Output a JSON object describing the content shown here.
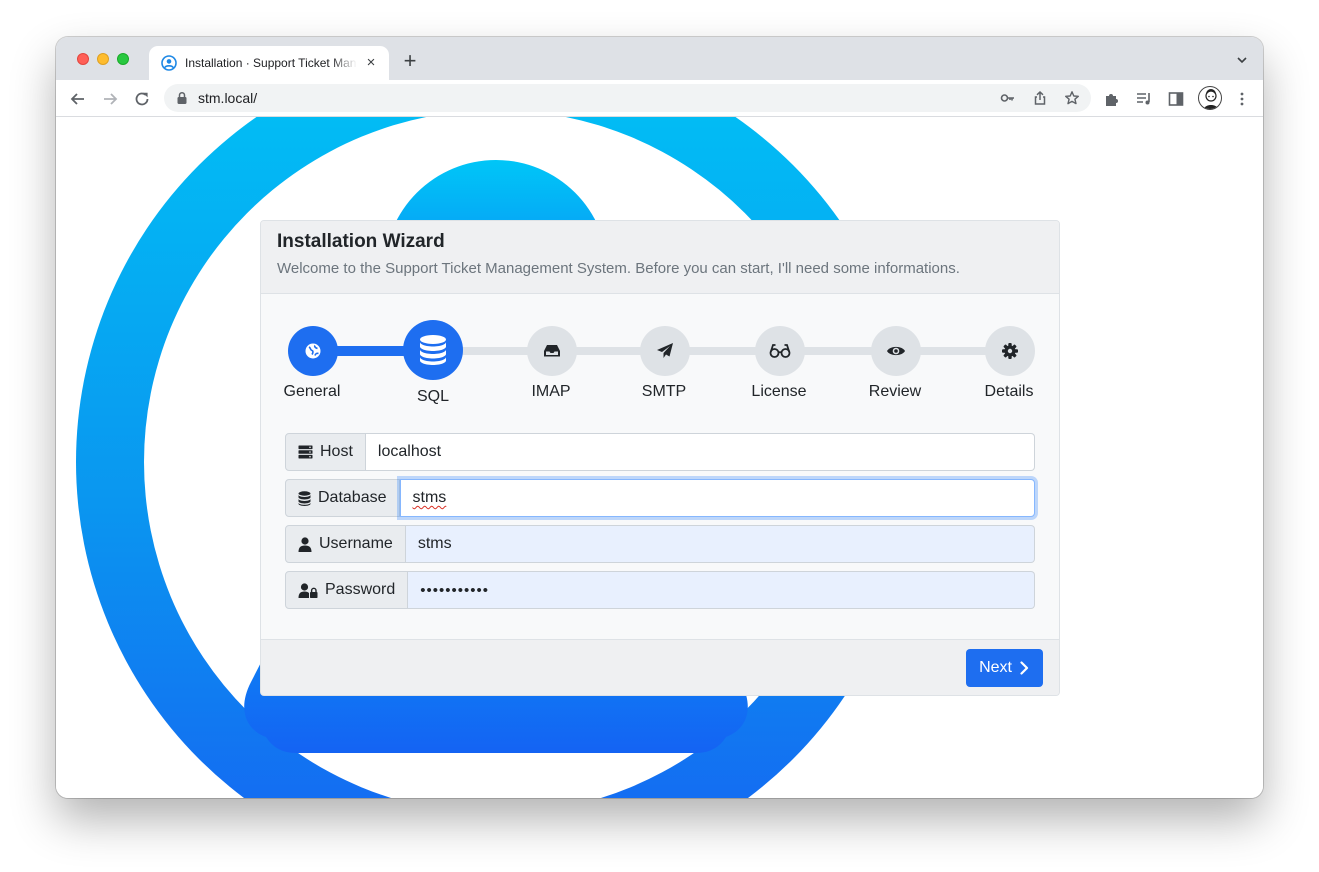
{
  "browser": {
    "tab_title": "Installation · Support Ticket Management System",
    "new_tab_label": "+",
    "close_label": "×",
    "url": "stm.local/"
  },
  "wizard": {
    "title": "Installation Wizard",
    "subtitle": "Welcome to the Support Ticket Management System. Before you can start, I'll need some informations.",
    "steps": [
      {
        "label": "General",
        "icon": "globe-icon",
        "state": "done"
      },
      {
        "label": "SQL",
        "icon": "database-icon",
        "state": "active"
      },
      {
        "label": "IMAP",
        "icon": "inbox-icon",
        "state": "pending"
      },
      {
        "label": "SMTP",
        "icon": "paper-plane-icon",
        "state": "pending"
      },
      {
        "label": "License",
        "icon": "glasses-icon",
        "state": "pending"
      },
      {
        "label": "Review",
        "icon": "eye-icon",
        "state": "pending"
      },
      {
        "label": "Details",
        "icon": "gear-icon",
        "state": "pending"
      }
    ],
    "fields": {
      "host": {
        "label": "Host",
        "value": "localhost"
      },
      "database": {
        "label": "Database",
        "value": "stms"
      },
      "username": {
        "label": "Username",
        "value": "stms"
      },
      "password": {
        "label": "Password",
        "value": "•••••••••••"
      }
    },
    "next_label": "Next"
  },
  "colors": {
    "primary": "#1e6ef0",
    "step_inactive": "#dee2e6",
    "autofill_bg": "#e8f0fe"
  }
}
